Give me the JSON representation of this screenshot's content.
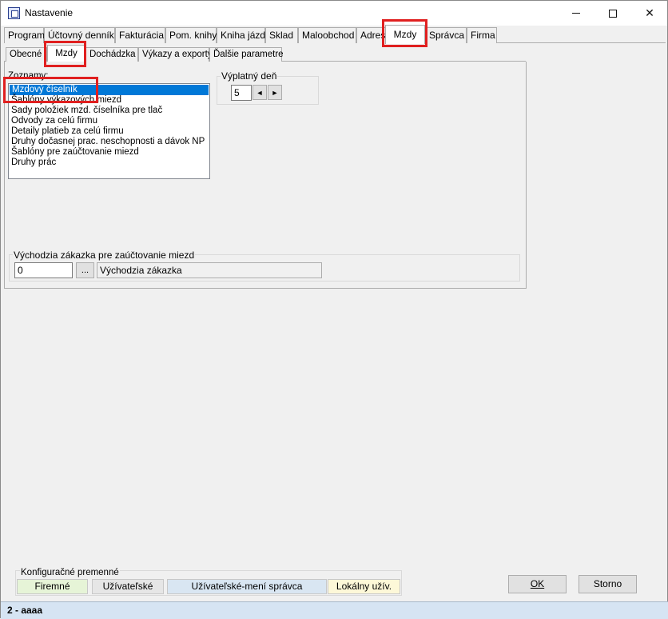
{
  "window": {
    "title": "Nastavenie",
    "minimize_glyph": "",
    "maximize_glyph": "",
    "close_glyph": "✕"
  },
  "main_tabs": [
    {
      "label": "Program"
    },
    {
      "label": "Účtovný denník"
    },
    {
      "label": "Fakturácia"
    },
    {
      "label": "Pom. knihy"
    },
    {
      "label": "Kniha jázd"
    },
    {
      "label": "Sklad"
    },
    {
      "label": "Maloobchod"
    },
    {
      "label": "Adres"
    },
    {
      "label": "Mzdy"
    },
    {
      "label": "Správca"
    },
    {
      "label": "Firma"
    }
  ],
  "sub_tabs": [
    {
      "label": "Obecné"
    },
    {
      "label": "Mzdy"
    },
    {
      "label": "Dochádzka"
    },
    {
      "label": "Výkazy a exporty"
    },
    {
      "label": "Ďalšie parametre"
    }
  ],
  "zoznamy": {
    "label": "Zoznamy:",
    "items": [
      "Mzdový číselník",
      "Šablóny výkazových miezd",
      "Sady položiek mzd. číselníka pre tlač",
      "Odvody za celú firmu",
      "Detaily platieb za celú firmu",
      "Druhy dočasnej prac. neschopnosti a dávok NP",
      "Šablóny pre zaúčtovanie miezd",
      "Druhy prác"
    ]
  },
  "vyplatny_den": {
    "label": "Výplatný deň",
    "value": "5",
    "left_arrow": "◄",
    "right_arrow": "►"
  },
  "zakazka": {
    "label": "Východzia zákazka pre zaúčtovanie miezd",
    "value": "0",
    "browse_label": "...",
    "name_value": "Východzia zákazka"
  },
  "config": {
    "label": "Konfiguračné premenné",
    "buttons": [
      {
        "label": "Firemné",
        "color": "#e6f4d7"
      },
      {
        "label": "Užívateľské",
        "color": "#e6e6e6"
      },
      {
        "label": "Užívateľské-mení správca",
        "color": "#d9e6f2"
      },
      {
        "label": "Lokálny užív.",
        "color": "#fdf8d8"
      }
    ]
  },
  "ok_label": "OK",
  "storno_label": "Storno",
  "status": "2 - aaaa"
}
